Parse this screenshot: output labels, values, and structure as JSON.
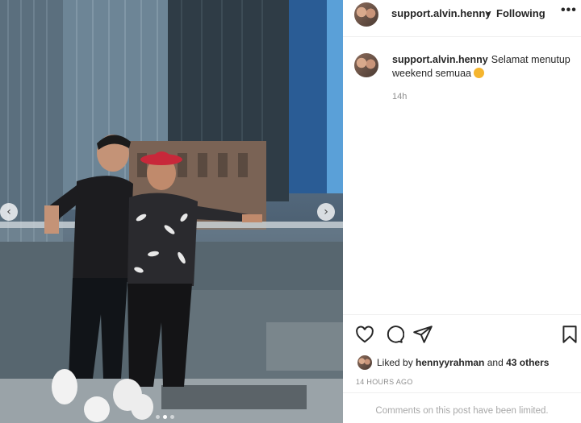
{
  "post": {
    "username": "support.alvin.henny",
    "separator": "•",
    "follow_status": "Following",
    "more_label": "•••",
    "caption_user": "support.alvin.henny",
    "caption_text": "Selamat menutup weekend semuaa",
    "caption_emoji": "smiling-face-emoji",
    "relative_time": "14h",
    "likes_prefix": "Liked by ",
    "likes_user": "hennyyrahman",
    "likes_middle": " and ",
    "likes_others": "43 others",
    "timestamp": "14 HOURS AGO",
    "comments_notice": "Comments on this post have been limited."
  },
  "media": {
    "prev_label": "‹",
    "next_label": "›",
    "carousel_dots": 3,
    "active_dot": 1
  },
  "icons": {
    "like": "heart-icon",
    "comment": "comment-icon",
    "share": "paper-plane-icon",
    "save": "bookmark-icon",
    "more": "ellipsis-icon"
  },
  "colors": {
    "text": "#262626",
    "muted": "#8e8e8e",
    "divider": "#efefef",
    "hat": "#c8283a"
  }
}
